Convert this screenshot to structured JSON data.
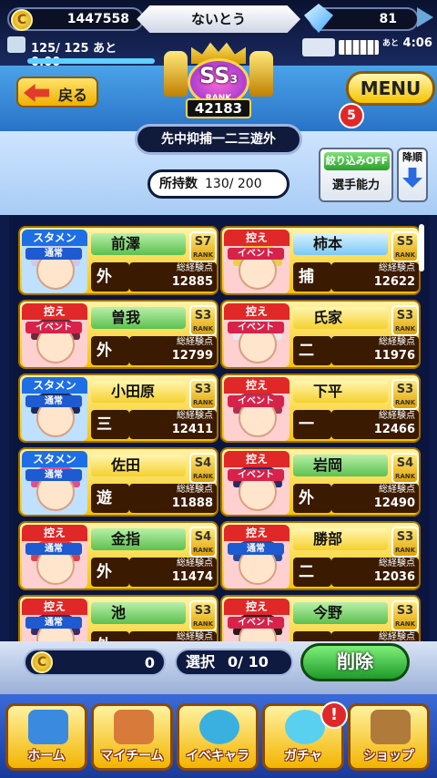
{
  "header": {
    "coins": "1447558",
    "username": "ないとう",
    "gems": "81",
    "stamina": "125/ 125 あと 0:00",
    "stamina_ratio": 1.0,
    "timer_prefix": "あと",
    "timer": "4:06",
    "back_label": "戻る",
    "menu_label": "MENU",
    "notification_count": "5"
  },
  "rank": {
    "label": "SS",
    "level": "3",
    "rank_text": "RANK",
    "points": "42183"
  },
  "filters": {
    "position_filter": "先中抑捕一二三遊外",
    "owned_label": "所持数",
    "owned_value": "130/ 200",
    "narrow_label": "絞り込みOFF",
    "sort_label": "選手能力",
    "order_label": "降順"
  },
  "colors": {
    "starter": "#1e6ee6",
    "bench": "#e02828",
    "normal": "#1e5ad0",
    "event": "#d8224a",
    "green_name": "#7ad870",
    "yellow_name": "#ffe04a",
    "blue_name": "#8fd4ff"
  },
  "cards": [
    {
      "status": "スタメン",
      "type": "通常",
      "name": "前澤",
      "rank": "S7",
      "position": "外",
      "exp_label": "総経験点",
      "exp": "12885",
      "name_color": "green",
      "status_color": "starter",
      "type_color": "normal",
      "hair": "#cfc8e8"
    },
    {
      "status": "控え",
      "type": "イベント",
      "name": "柿本",
      "rank": "S5",
      "position": "捕",
      "exp_label": "総経験点",
      "exp": "12622",
      "name_color": "blue",
      "status_color": "bench",
      "type_color": "event",
      "hair": "#f0d040"
    },
    {
      "status": "控え",
      "type": "イベント",
      "name": "曽我",
      "rank": "S3",
      "position": "外",
      "exp_label": "総経験点",
      "exp": "12799",
      "name_color": "green",
      "status_color": "bench",
      "type_color": "event",
      "hair": "#6a2a3a"
    },
    {
      "status": "控え",
      "type": "イベント",
      "name": "氏家",
      "rank": "S3",
      "position": "二",
      "exp_label": "総経験点",
      "exp": "11976",
      "name_color": "yellow",
      "status_color": "bench",
      "type_color": "event",
      "hair": "#e8e8f0"
    },
    {
      "status": "スタメン",
      "type": "通常",
      "name": "小田原",
      "rank": "S3",
      "position": "三",
      "exp_label": "総経験点",
      "exp": "12411",
      "name_color": "yellow",
      "status_color": "starter",
      "type_color": "normal",
      "hair": "#1a2a5a"
    },
    {
      "status": "控え",
      "type": "イベント",
      "name": "下平",
      "rank": "S3",
      "position": "一",
      "exp_label": "総経験点",
      "exp": "12466",
      "name_color": "yellow",
      "status_color": "bench",
      "type_color": "event",
      "hair": "#b03050"
    },
    {
      "status": "スタメン",
      "type": "通常",
      "name": "佐田",
      "rank": "S4",
      "position": "遊",
      "exp_label": "総経験点",
      "exp": "11888",
      "name_color": "yellow",
      "status_color": "starter",
      "type_color": "normal",
      "hair": "#e05090"
    },
    {
      "status": "控え",
      "type": "イベント",
      "name": "岩岡",
      "rank": "S4",
      "position": "外",
      "exp_label": "総経験点",
      "exp": "12490",
      "name_color": "green",
      "status_color": "bench",
      "type_color": "event",
      "hair": "#2a2a6a"
    },
    {
      "status": "控え",
      "type": "通常",
      "name": "金指",
      "rank": "S4",
      "position": "外",
      "exp_label": "総経験点",
      "exp": "11474",
      "name_color": "green",
      "status_color": "bench",
      "type_color": "normal",
      "hair": "#d84050"
    },
    {
      "status": "控え",
      "type": "通常",
      "name": "勝部",
      "rank": "S3",
      "position": "二",
      "exp_label": "総経験点",
      "exp": "12036",
      "name_color": "yellow",
      "status_color": "bench",
      "type_color": "normal",
      "hair": "#2a4aa0"
    },
    {
      "status": "控え",
      "type": "通常",
      "name": "池",
      "rank": "S3",
      "position": "外",
      "exp_label": "総経験点",
      "exp": "",
      "name_color": "green",
      "status_color": "bench",
      "type_color": "normal",
      "hair": "#3a2a6a"
    },
    {
      "status": "控え",
      "type": "イベント",
      "name": "今野",
      "rank": "S3",
      "position": "",
      "exp_label": "総経験点",
      "exp": "",
      "name_color": "green",
      "status_color": "bench",
      "type_color": "event",
      "hair": "#2a1a1a"
    }
  ],
  "bottom": {
    "coins": "0",
    "select_label": "選択",
    "select_count": "0/ 10",
    "delete_label": "削除"
  },
  "nav": [
    {
      "label": "ホーム",
      "icon": "home-icon"
    },
    {
      "label": "マイチーム",
      "icon": "team-icon"
    },
    {
      "label": "イベキャラ",
      "icon": "event-character-icon"
    },
    {
      "label": "ガチャ",
      "icon": "gacha-icon"
    },
    {
      "label": "ショップ",
      "icon": "shop-icon"
    }
  ],
  "nav_badge": "!"
}
